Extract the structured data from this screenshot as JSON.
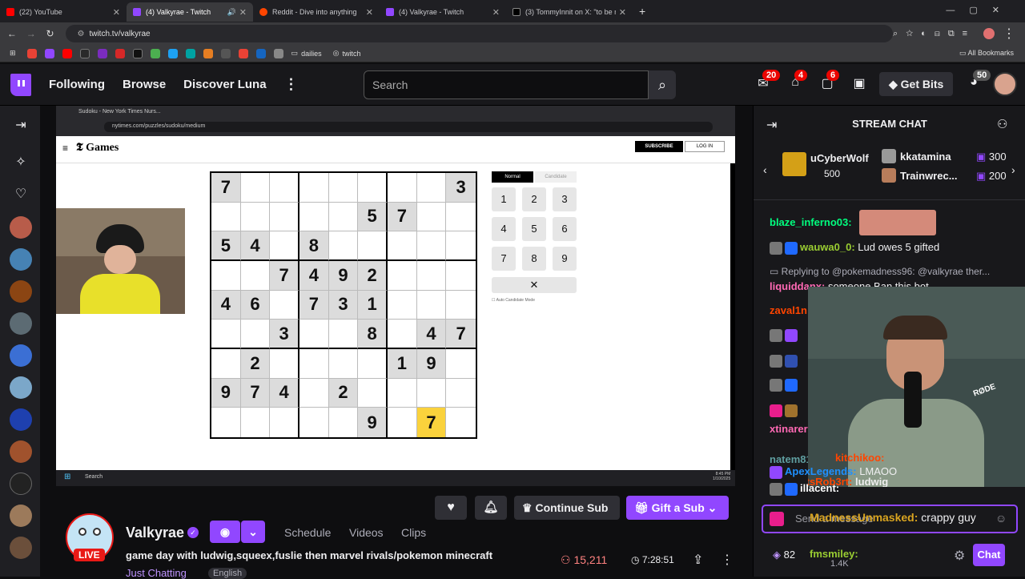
{
  "browser": {
    "tabs": [
      {
        "title": "(22) YouTube",
        "color": "#ff0000"
      },
      {
        "title": "(4) Valkyrae - Twitch",
        "color": "#9147ff"
      },
      {
        "title": "Reddit - Dive into anything",
        "color": "#ff4500"
      },
      {
        "title": "(4) Valkyrae - Twitch",
        "color": "#9147ff"
      },
      {
        "title": "(3) TommyInnit on X: \"to be mo",
        "color": "#000000"
      }
    ],
    "url": "twitch.tv/valkyrae",
    "bookmarks": [
      "dailies",
      "twitch"
    ],
    "all_bookmarks": "All Bookmarks"
  },
  "topnav": {
    "following": "Following",
    "browse": "Browse",
    "discover": "Discover Luna",
    "search_placeholder": "Search",
    "badge_1": "20",
    "badge_2": "4",
    "badge_3": "6",
    "get_bits": "Get Bits",
    "avatar_badge": "50"
  },
  "video": {
    "inner_tab": "Sudoku - New York Times Nurs...",
    "inner_url": "nytimes.com/puzzles/sudoku/medium",
    "nyt_logo": "Games",
    "subscribe": "SUBSCRIBE",
    "login": "LOG IN",
    "mode_normal": "Normal",
    "mode_candidate": "Candidate",
    "auto_candidate": "Auto Candidate Mode",
    "clear_symbol": "✕",
    "numpad": [
      "1",
      "2",
      "3",
      "4",
      "5",
      "6",
      "7",
      "8",
      "9"
    ],
    "grid": [
      [
        "7",
        "",
        "",
        "",
        "",
        "",
        "",
        "",
        "3"
      ],
      [
        "",
        "",
        "",
        "",
        "",
        "5",
        "7",
        "",
        ""
      ],
      [
        "5",
        "4",
        "",
        "8",
        "",
        "",
        "",
        "",
        ""
      ],
      [
        "",
        "",
        "7",
        "4",
        "9",
        "2",
        "",
        "",
        ""
      ],
      [
        "4",
        "6",
        "",
        "7",
        "3",
        "1",
        "",
        "",
        ""
      ],
      [
        "",
        "",
        "3",
        "",
        "",
        "8",
        "",
        "4",
        "7"
      ],
      [
        "",
        "2",
        "",
        "",
        "",
        "",
        "1",
        "9",
        ""
      ],
      [
        "9",
        "7",
        "4",
        "",
        "2",
        "",
        "",
        "",
        ""
      ],
      [
        "",
        "",
        "",
        "",
        "",
        "9",
        "",
        "7",
        ""
      ]
    ],
    "taskbar_search": "Search",
    "taskbar_time": "8:45 PM",
    "taskbar_date": "1/10/2025"
  },
  "stream": {
    "streamer": "Valkyrae",
    "live": "LIVE",
    "title": "game day with ludwig,squeex,fuslie then marvel rivals/pokemon minecraft",
    "category": "Just Chatting",
    "language": "English",
    "schedule": "Schedule",
    "videos": "Videos",
    "clips": "Clips",
    "continue_sub": "Continue Sub",
    "gift_sub": "Gift a Sub",
    "viewers": "15,211",
    "uptime": "7:28:51"
  },
  "chat": {
    "header": "STREAM CHAT",
    "gifters": [
      {
        "name": "uCyberWolf",
        "count": "500"
      },
      {
        "name": "kkatamina",
        "count": "300"
      },
      {
        "name": "Trainwrec...",
        "count": "200"
      }
    ],
    "messages": [
      {
        "user": "blaze_inferno03:",
        "text": "",
        "color": "#00ff7f"
      },
      {
        "user": "wauwa0_0:",
        "text": " Lud owes 5 gifted",
        "color": "#9acd32"
      },
      {
        "user": "Replying to @pokemadness96:",
        "text": " @valkyrae ther...",
        "color": "#adadb8"
      },
      {
        "user": "liquiddanx:",
        "text": " someone Ban this bot",
        "color": "#ff69b4"
      },
      {
        "user": "zaval1n",
        "text": "",
        "color": "#ff4500"
      },
      {
        "user": "xtinarer",
        "text": "",
        "color": "#ff69b4"
      },
      {
        "user": "natem81",
        "text": "",
        "color": "#5f9ea0"
      },
      {
        "user": "ApexLegends:",
        "text": " LMAOO",
        "color": "#1e90ff"
      },
      {
        "user": "MadnessUnmasked:",
        "text": " crappy guy",
        "color": "#daa520"
      },
      {
        "user": "fmsmiley:",
        "text": "",
        "color": "#9acd32"
      }
    ],
    "overlay_names": [
      "kitchikoo:",
      "ItsRob3rt:",
      "ludwig",
      "illacent:"
    ],
    "input_placeholder": "Send a message",
    "points": "82",
    "points2": "1.4K",
    "send": "Chat"
  }
}
